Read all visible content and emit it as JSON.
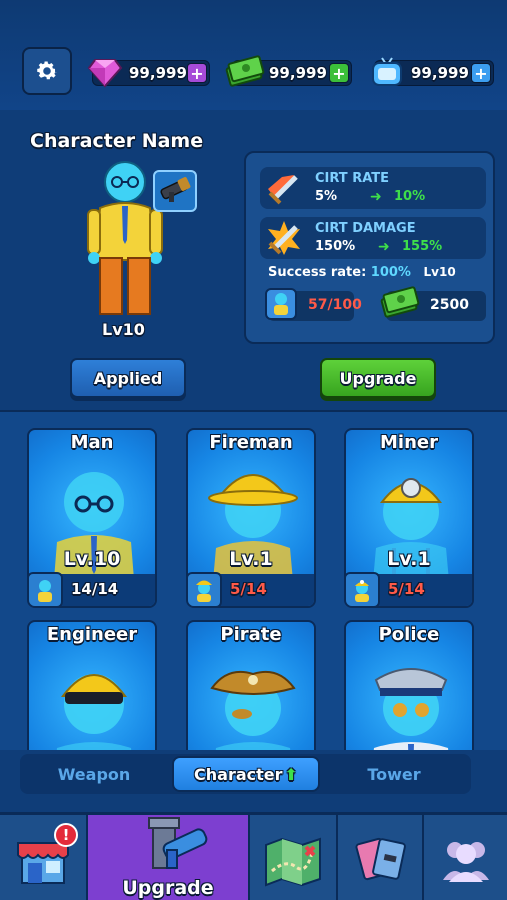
{
  "topbar": {
    "settings_icon": "gear-icon",
    "currencies": [
      {
        "name": "gems",
        "icon": "gem-icon",
        "value": "99,999",
        "plus_color": "#a64bd8",
        "plus": "+"
      },
      {
        "name": "cash",
        "icon": "cash-icon",
        "value": "99,999",
        "plus_color": "#3cbf3a",
        "plus": "+"
      },
      {
        "name": "tv",
        "icon": "tv-icon",
        "value": "99,999",
        "plus_color": "#3c9ef0",
        "plus": "+"
      }
    ]
  },
  "character": {
    "name": "Character Name",
    "level": "Lv10",
    "weapon_icon": "rocket-launcher-icon"
  },
  "stats": {
    "crit_rate": {
      "label": "CIRT RATE",
      "current": "5%",
      "next": "10%"
    },
    "crit_damage": {
      "label": "CIRT DAMAGE",
      "current": "150%",
      "next": "155%"
    },
    "success_label": "Success rate:",
    "success_value": "100%",
    "success_level": "Lv10",
    "cost_cards": "57/100",
    "cost_cash": "2500"
  },
  "actions": {
    "applied_label": "Applied",
    "upgrade_label": "Upgrade"
  },
  "characters": [
    {
      "name": "Man",
      "level": "Lv.10",
      "progress": "14/14",
      "complete": true,
      "hat": "none"
    },
    {
      "name": "Fireman",
      "level": "Lv.1",
      "progress": "5/14",
      "complete": false,
      "hat": "fire-helmet"
    },
    {
      "name": "Miner",
      "level": "Lv.1",
      "progress": "5/14",
      "complete": false,
      "hat": "miner-helmet"
    },
    {
      "name": "Engineer",
      "level": "",
      "progress": "",
      "complete": false,
      "hat": "hard-hat"
    },
    {
      "name": "Pirate",
      "level": "",
      "progress": "",
      "complete": false,
      "hat": "pirate-hat"
    },
    {
      "name": "Police",
      "level": "",
      "progress": "",
      "complete": false,
      "hat": "police-cap"
    }
  ],
  "tabs": [
    {
      "label": "Weapon",
      "active": false
    },
    {
      "label": "Character",
      "active": true
    },
    {
      "label": "Tower",
      "active": false
    }
  ],
  "bottomnav": [
    {
      "name": "shop",
      "icon": "shop-icon",
      "label": "",
      "badge": "!",
      "active": false
    },
    {
      "name": "upgrade",
      "icon": "blaster-tower-icon",
      "label": "Upgrade",
      "badge": "",
      "active": true
    },
    {
      "name": "map",
      "icon": "map-icon",
      "label": "",
      "badge": "",
      "active": false
    },
    {
      "name": "cards",
      "icon": "cards-icon",
      "label": "",
      "badge": "",
      "active": false
    },
    {
      "name": "social",
      "icon": "people-icon",
      "label": "",
      "badge": "",
      "active": false
    }
  ]
}
